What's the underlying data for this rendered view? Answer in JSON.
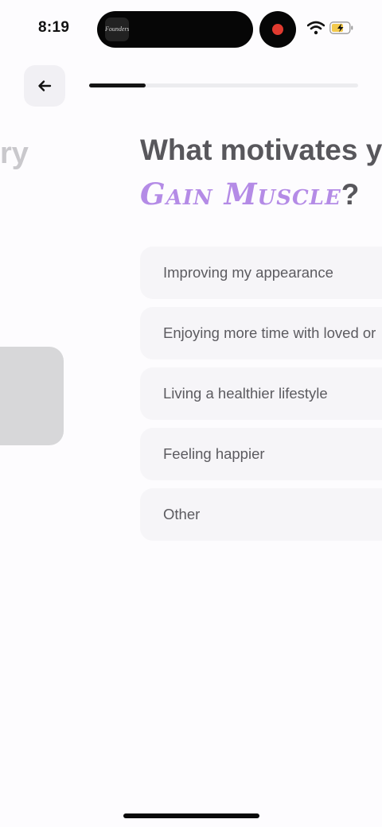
{
  "status_bar": {
    "time": "8:19",
    "island_thumb_text": "Founders",
    "record_color": "#e03a2f",
    "battery_color": "#f2c94c"
  },
  "header": {
    "back_icon": "arrow-left-icon",
    "progress": 0.21
  },
  "previous_slide": {
    "title_fragment": "ry"
  },
  "question": {
    "prefix": "What motivates y",
    "goal": "Gain Muscle",
    "suffix": "?",
    "goal_color": "#b48be6"
  },
  "options": [
    {
      "label": "Improving my appearance"
    },
    {
      "label": "Enjoying more time with loved or"
    },
    {
      "label": "Living a healthier lifestyle"
    },
    {
      "label": "Feeling happier"
    },
    {
      "label": "Other"
    }
  ]
}
